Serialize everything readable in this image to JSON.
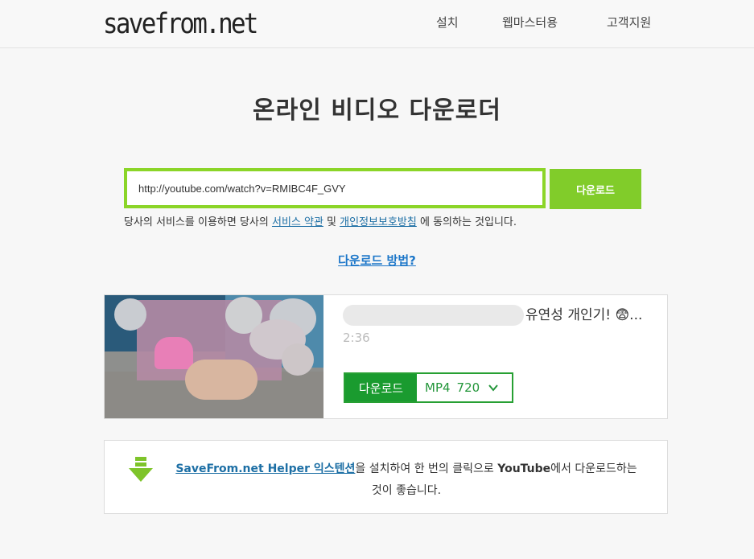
{
  "header": {
    "logo": "savefrom.net",
    "nav": [
      "설치",
      "웹마스터용",
      "고객지원"
    ]
  },
  "main": {
    "title": "온라인 비디오 다운로더",
    "url_value": "http://youtube.com/watch?v=RMIBC4F_GVY",
    "download_button": "다운로드",
    "terms": {
      "before": "당사의 서비스를 이용하면 당사의 ",
      "terms_link": "서비스 약관",
      "middle": " 및 ",
      "privacy_link": "개인정보보호방침",
      "after": " 에 동의하는 것입니다."
    },
    "howto_link": "다운로드 방법?"
  },
  "result": {
    "title_visible": "유연성 개인기! 😨...",
    "duration": "2:36",
    "download_label": "다운로드",
    "format": "MP4",
    "quality": "720"
  },
  "helper": {
    "link": "SaveFrom.net Helper 익스텐션",
    "text1": "을 설치하여 한 번의 클릭으로 ",
    "brand": "YouTube",
    "text2": "에서 다운로드하는",
    "text3": "것이 좋습니다."
  },
  "colors": {
    "accent_green": "#81cc2a",
    "download_green": "#1a9b2f",
    "link_blue": "#1d6fa5"
  }
}
